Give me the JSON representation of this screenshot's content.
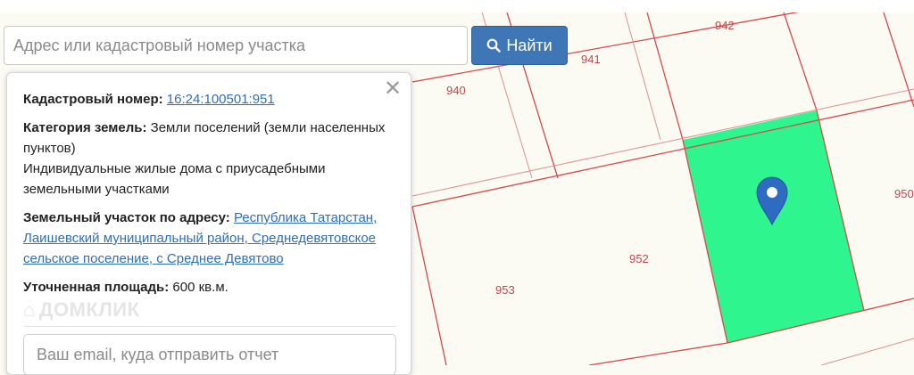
{
  "search": {
    "placeholder": "Адрес или кадастровый номер участка",
    "button_label": "Найти",
    "button_icon": "search-icon"
  },
  "map": {
    "highlight_color": "#2ff58f",
    "line_color": "#d64a4a",
    "parcels": [
      "942",
      "941",
      "940",
      "950",
      "952",
      "953"
    ]
  },
  "info": {
    "cadastral_label": "Кадастровый номер:",
    "cadastral_value": "16:24:100501:951",
    "category_label": "Категория земель:",
    "category_value": "Земли поселений (земли населенных пунктов)",
    "usage": "Индивидуальные жилые дома с приусадебными земельными участками",
    "address_label": "Земельный участок по адресу:",
    "address_value": "Республика Татарстан, Лаишевский муниципальный район, Среднедевятовское сельское поселение, с Среднее Девятово",
    "area_label": "Уточненная площадь:",
    "area_value": "600 кв.м.",
    "watermark": "ДОМКЛИК",
    "email_placeholder": "Ваш email, куда отправить отчет",
    "close_icon": "close-icon"
  }
}
